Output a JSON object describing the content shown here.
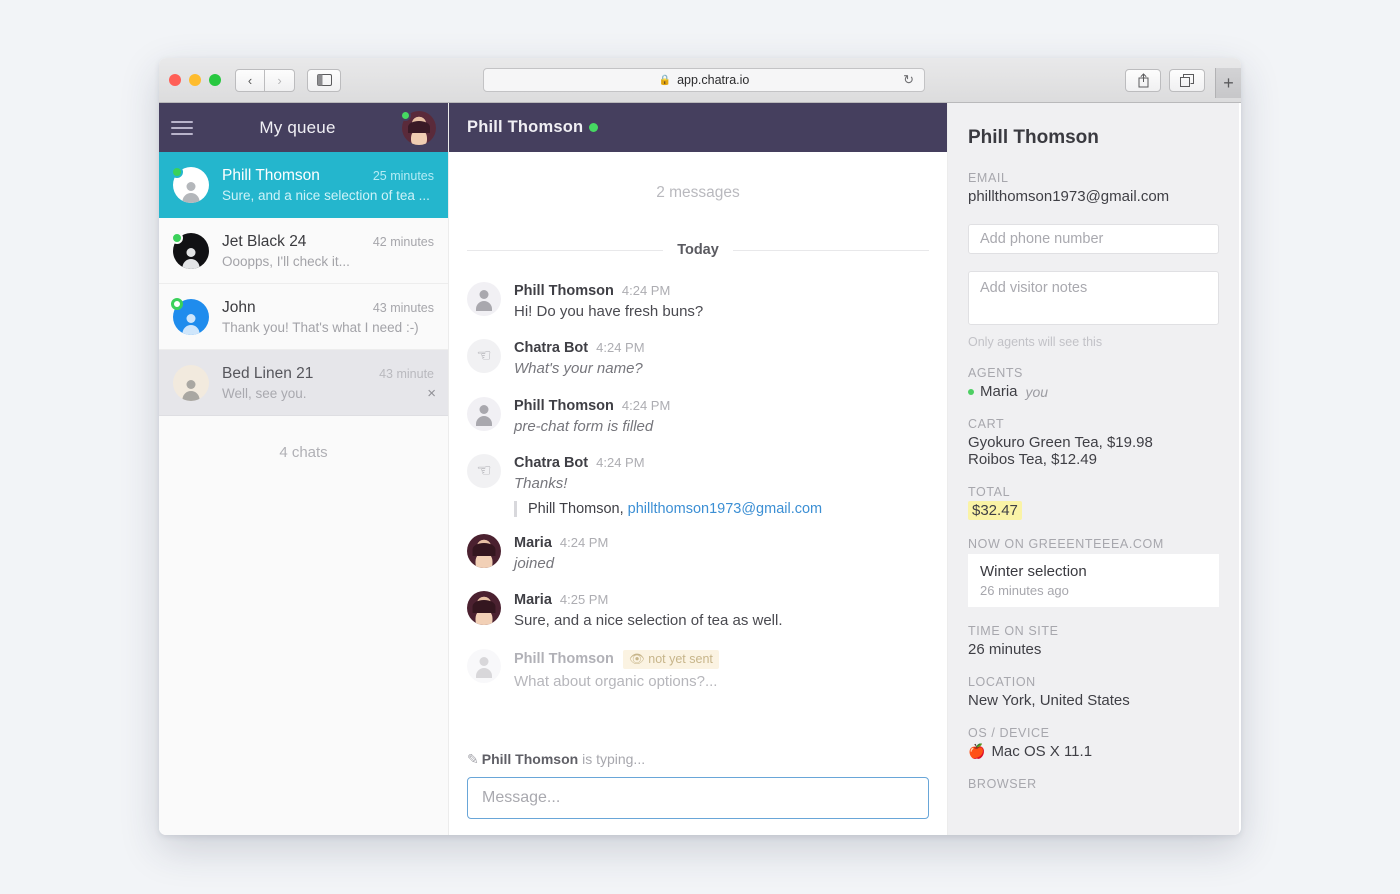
{
  "browser": {
    "url": "app.chatra.io",
    "lock_icon": "lock-icon",
    "back_icon": "‹",
    "forward_icon": "›",
    "sidebar_icon": "sidebar-icon",
    "reload_icon": "↻",
    "share_icon": "share-icon",
    "tabs_icon": "tabs-icon",
    "new_tab_icon": "+"
  },
  "queue": {
    "title": "My queue",
    "menu_icon": "hamburger-icon",
    "agent_status": "online",
    "count_label": "4 chats",
    "chats": [
      {
        "name": "Phill Thomson",
        "time": "25 minutes",
        "preview": "Sure, and a nice selection of tea ...",
        "avatar": "av-white",
        "status": "online-solid",
        "state": "active"
      },
      {
        "name": "Jet Black 24",
        "time": "42 minutes",
        "preview": "Ooopps, I'll check it...",
        "avatar": "av-black",
        "status": "online-solid",
        "state": "normal"
      },
      {
        "name": "John",
        "time": "43 minutes",
        "preview": "Thank you! That's what I need :-)",
        "avatar": "av-blue",
        "status": "online-hollow",
        "state": "normal"
      },
      {
        "name": "Bed Linen 21",
        "time": "43 minute",
        "preview": "Well, see you.",
        "avatar": "av-cream",
        "status": "none",
        "state": "closing",
        "close_icon": "×"
      }
    ]
  },
  "conversation": {
    "header_name": "Phill Thomson",
    "header_status": "online",
    "message_count_label": "2 messages",
    "day_separator": "Today",
    "messages": [
      {
        "author": "Phill Thomson",
        "time": "4:24 PM",
        "text": "Hi! Do you have fresh buns?",
        "avatar": "guest",
        "style": "normal"
      },
      {
        "author": "Chatra Bot",
        "time": "4:24 PM",
        "text": "What's your name?",
        "avatar": "bot",
        "style": "italic"
      },
      {
        "author": "Phill Thomson",
        "time": "4:24 PM",
        "text": "pre-chat form is filled",
        "avatar": "guest",
        "style": "italic"
      },
      {
        "author": "Chatra Bot",
        "time": "4:24 PM",
        "text": "Thanks!",
        "avatar": "bot",
        "style": "italic",
        "quote_name": "Phill Thomson,",
        "quote_email": "phillthomson1973@gmail.com"
      },
      {
        "author": "Maria",
        "time": "4:24 PM",
        "text": "joined",
        "avatar": "maria",
        "style": "italic"
      },
      {
        "author": "Maria",
        "time": "4:25 PM",
        "text": "Sure, and a nice selection of tea as well.",
        "avatar": "maria",
        "style": "normal"
      },
      {
        "author": "Phill Thomson",
        "time": "",
        "text": "What about organic options?...",
        "avatar": "guest",
        "style": "pending",
        "badge": "not yet sent",
        "badge_icon": "eye-slash-icon"
      }
    ],
    "typing_icon": "pencil-icon",
    "typing_name": "Phill Thomson",
    "typing_suffix": " is typing...",
    "composer_placeholder": "Message..."
  },
  "visitor": {
    "name": "Phill Thomson",
    "email_label": "EMAIL",
    "email": "phillthomson1973@gmail.com",
    "phone_placeholder": "Add phone number",
    "notes_placeholder": "Add visitor notes",
    "notes_hint": "Only agents will see this",
    "agents_label": "AGENTS",
    "agent_name": "Maria",
    "agent_you": "you",
    "cart_label": "CART",
    "cart_items": [
      "Gyokuro Green Tea, $19.98",
      "Roibos Tea, $12.49"
    ],
    "total_label": "TOTAL",
    "total_value": "$32.47",
    "now_on_label": "NOW ON GREEENTEEEA.COM",
    "now_on_page": "Winter selection",
    "now_on_time": "26 minutes ago",
    "time_on_site_label": "TIME ON SITE",
    "time_on_site": "26 minutes",
    "location_label": "LOCATION",
    "location": "New York, United States",
    "os_label": "OS / DEVICE",
    "os_icon": "apple-icon",
    "os": "Mac OS X 11.1",
    "browser_label": "BROWSER"
  },
  "colors": {
    "purple_header": "#453f5e",
    "active_chat": "#24b6cd",
    "online_green": "#46d962",
    "link_blue": "#3c8fd4",
    "highlight_yellow": "#faf3a6",
    "pending_badge_bg": "#fbf3e2"
  }
}
